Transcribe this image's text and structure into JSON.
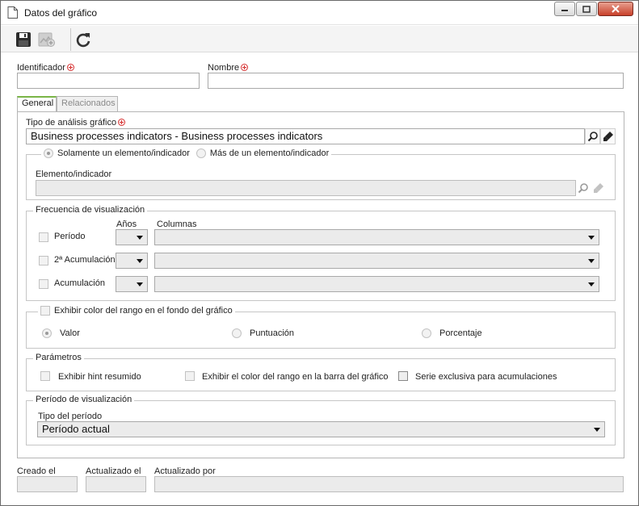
{
  "window": {
    "title": "Datos del gráfico"
  },
  "toolbar": {
    "save": "save-icon",
    "save_disabled": "save-new-icon",
    "refresh": "refresh-icon"
  },
  "form": {
    "identificador_label": "Identificador",
    "identificador_value": "",
    "nombre_label": "Nombre",
    "nombre_value": ""
  },
  "tabs": [
    {
      "label": "General",
      "active": true
    },
    {
      "label": "Relacionados",
      "active": false
    }
  ],
  "general": {
    "tipo_analisis_label": "Tipo de análisis gráfico",
    "tipo_analisis_value": "Business processes indicators - Business processes indicators",
    "radio_solamente": "Solamente un elemento/indicador",
    "radio_mas": "Más de un elemento/indicador",
    "elemento_label": "Elemento/indicador",
    "elemento_value": "",
    "frecuencia": {
      "legend": "Frecuencia de visualización",
      "col_anos": "Años",
      "col_columnas": "Columnas",
      "rows": [
        {
          "label": "Período"
        },
        {
          "label": "2ª Acumulación"
        },
        {
          "label": "Acumulación"
        }
      ]
    },
    "rango": {
      "legend": "Exhibir color del rango en el fondo del gráfico",
      "opt_valor": "Valor",
      "opt_puntuacion": "Puntuación",
      "opt_porcentaje": "Porcentaje"
    },
    "parametros": {
      "legend": "Parámetros",
      "hint": "Exhibir hint resumido",
      "color_barra": "Exhibir el color del rango en la barra del gráfico",
      "serie": "Serie exclusiva para acumulaciones"
    },
    "periodo": {
      "legend": "Período de visualización",
      "tipo_label": "Tipo del período",
      "tipo_value": "Período actual"
    }
  },
  "footer": {
    "creado_label": "Creado el",
    "actualizado_label": "Actualizado el",
    "actualizado_por_label": "Actualizado por"
  }
}
